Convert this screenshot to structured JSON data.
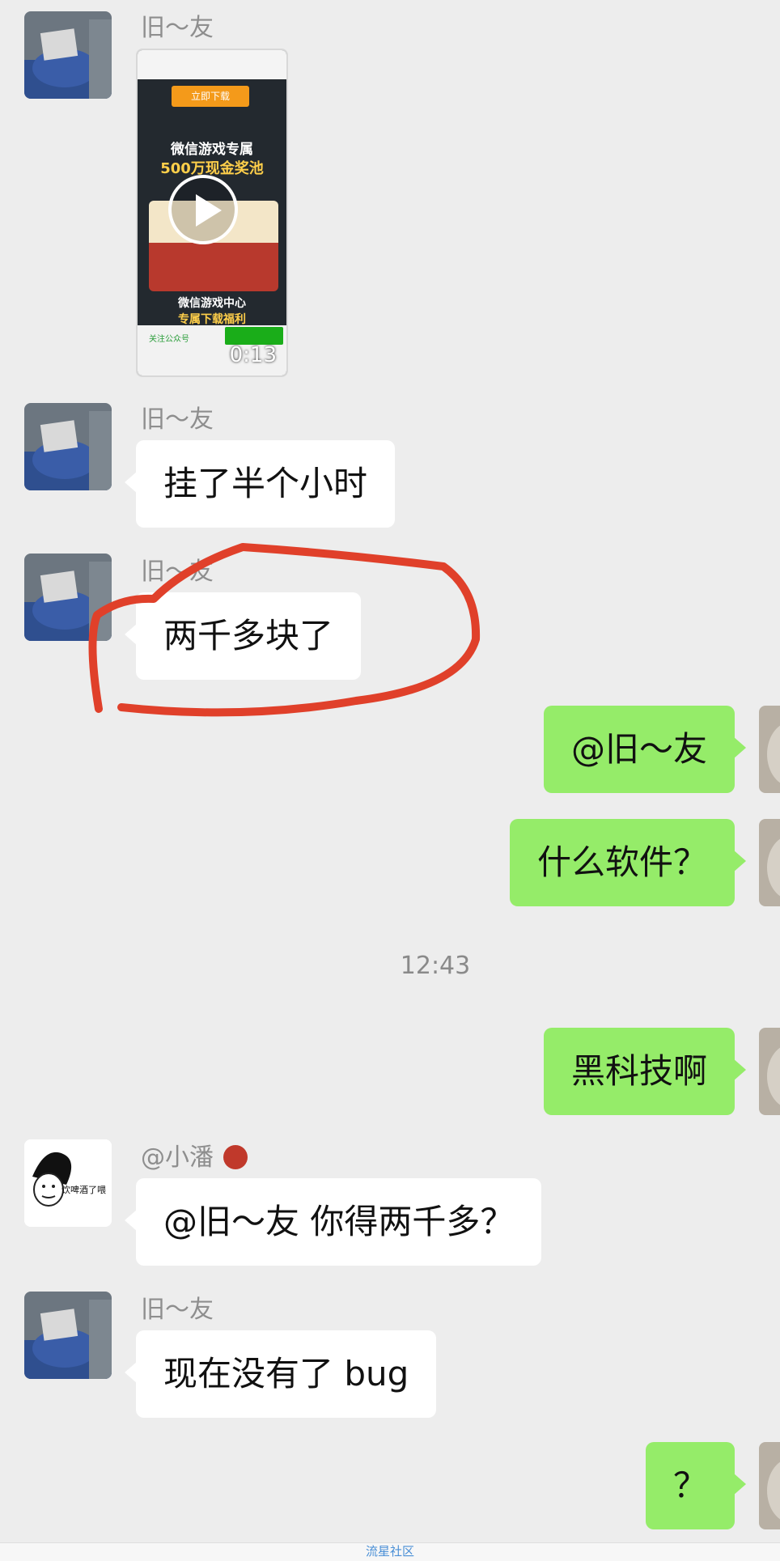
{
  "messages": [
    {
      "sender": "旧～友",
      "type": "video",
      "duration": "0:13",
      "thumbnail": {
        "download_label": "立即下载",
        "headline1": "微信游戏专属",
        "headline2": "500万现金奖池",
        "bottom1": "微信游戏中心",
        "bottom2": "专属下载福利",
        "footer_left": "关注公众号"
      }
    },
    {
      "sender": "旧～友",
      "type": "text",
      "text": "挂了半个小时"
    },
    {
      "sender": "旧～友",
      "type": "text",
      "text": "两千多块了"
    },
    {
      "sender": "me",
      "type": "text",
      "text": "@旧～友"
    },
    {
      "sender": "me",
      "type": "text",
      "text": "什么软件？"
    },
    {
      "type": "timestamp",
      "text": "12:43"
    },
    {
      "sender": "me",
      "type": "text",
      "text": "黑科技啊"
    },
    {
      "sender": "@小潘",
      "type": "text",
      "text": "@旧～友  你得两千多？"
    },
    {
      "sender": "旧～友",
      "type": "text",
      "text": "现在没有了 bug"
    },
    {
      "sender": "me",
      "type": "text",
      "text": "？"
    }
  ],
  "avatars": {
    "xiaopan_caption": "饮啤酒了喂"
  },
  "watermark": "流星社区",
  "colors": {
    "background": "#ededed",
    "sent_bubble": "#95ec69",
    "received_bubble": "#ffffff",
    "annotation": "#e0402a"
  }
}
